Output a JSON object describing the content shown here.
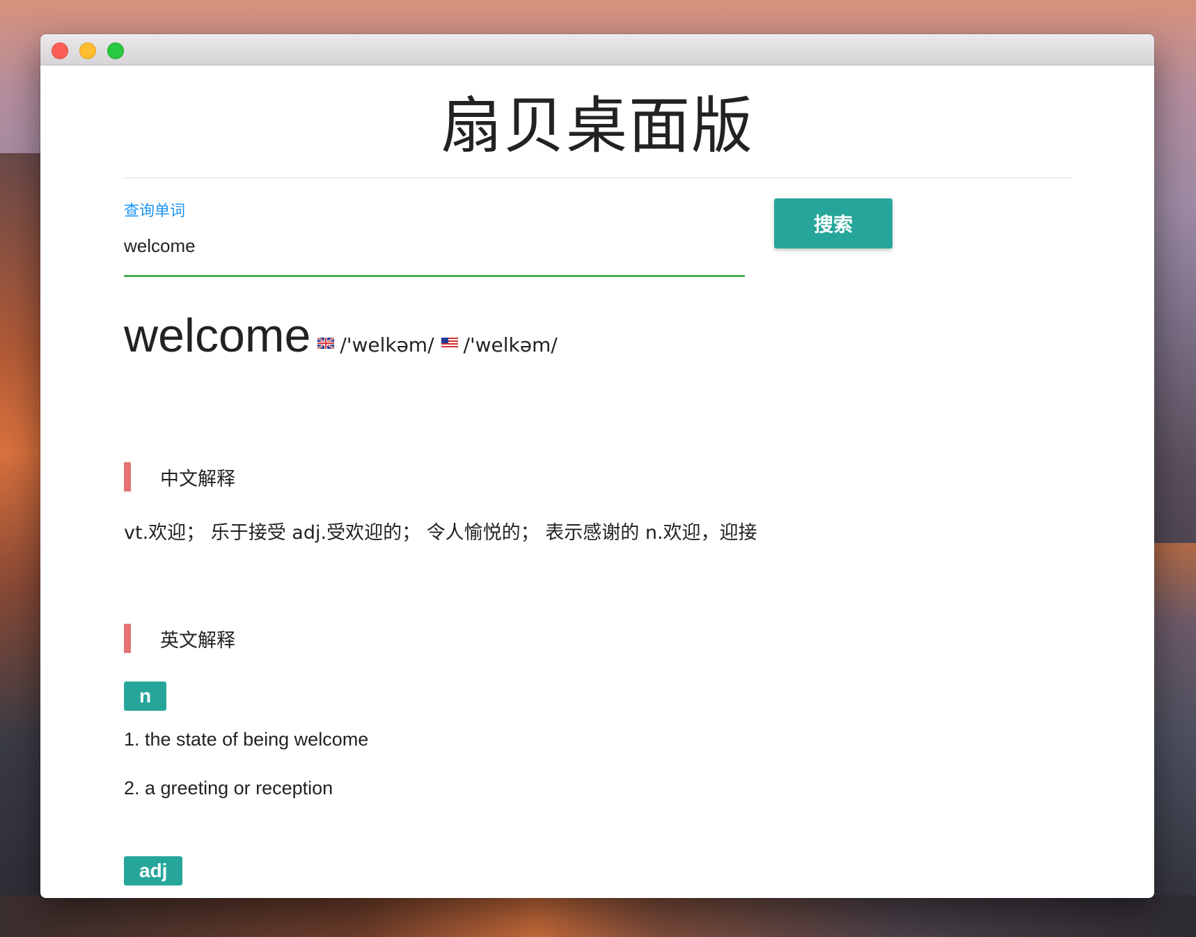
{
  "app": {
    "title": "扇贝桌面版"
  },
  "search": {
    "label": "查询单词",
    "value": "welcome",
    "button_label": "搜索"
  },
  "word": {
    "headword": "welcome",
    "phonetic_uk": "/'welkəm/",
    "phonetic_us": "/'welkəm/",
    "flag_uk": "uk-flag-icon",
    "flag_us": "us-flag-icon"
  },
  "chinese_section": {
    "title": "中文解释",
    "definition": "vt.欢迎； 乐于接受 adj.受欢迎的； 令人愉悦的； 表示感谢的 n.欢迎，迎接"
  },
  "english_section": {
    "title": "英文解释",
    "groups": [
      {
        "pos": "n",
        "definitions": [
          "1. the state of being welcome",
          "2. a greeting or reception"
        ]
      },
      {
        "pos": "adj",
        "definitions": []
      }
    ]
  },
  "colors": {
    "accent_teal": "#26a69a",
    "label_blue": "#2196f3",
    "underline_green": "#4caf50",
    "section_bar_red": "#e57373"
  }
}
